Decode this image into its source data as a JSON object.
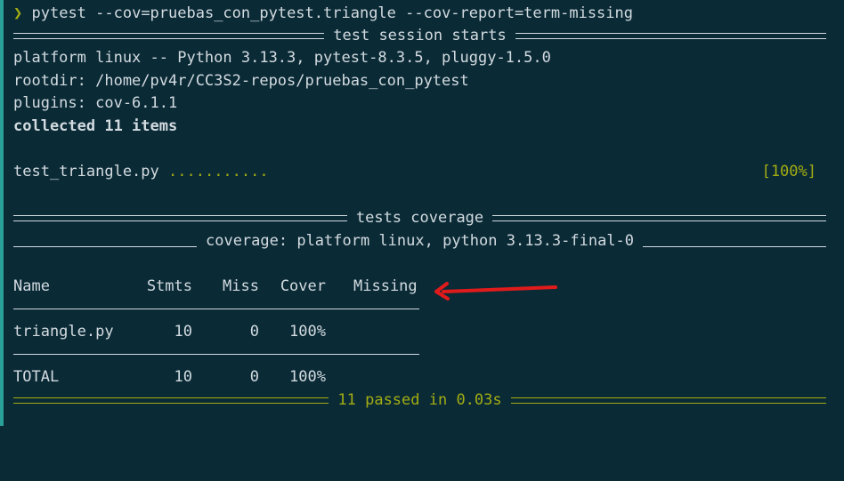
{
  "prompt_symbol": "❯",
  "command": "pytest --cov=pruebas_con_pytest.triangle --cov-report=term-missing",
  "session_header": "test session starts",
  "platform_line": "platform linux -- Python 3.13.3, pytest-8.3.5, pluggy-1.5.0",
  "rootdir_line": "rootdir: /home/pv4r/CC3S2-repos/pruebas_con_pytest",
  "plugins_line": "plugins: cov-6.1.1",
  "collected_line": "collected 11 items",
  "test_file": "test_triangle.py",
  "test_dots": "...........",
  "test_progress": "[100%]",
  "coverage_header": "tests coverage",
  "coverage_subheader": "coverage: platform linux, python 3.13.3-final-0",
  "table": {
    "headers": [
      "Name",
      "Stmts",
      "Miss",
      "Cover",
      "Missing"
    ],
    "rows": [
      [
        "triangle.py",
        "10",
        "0",
        "100%",
        ""
      ]
    ],
    "total": [
      "TOTAL",
      "10",
      "0",
      "100%",
      ""
    ]
  },
  "summary": "11 passed in 0.03s",
  "colors": {
    "background": "#0a2a36",
    "text": "#d3dbe0",
    "pass_green": "#a3ad12",
    "annotation_arrow": "#e01b1b"
  }
}
